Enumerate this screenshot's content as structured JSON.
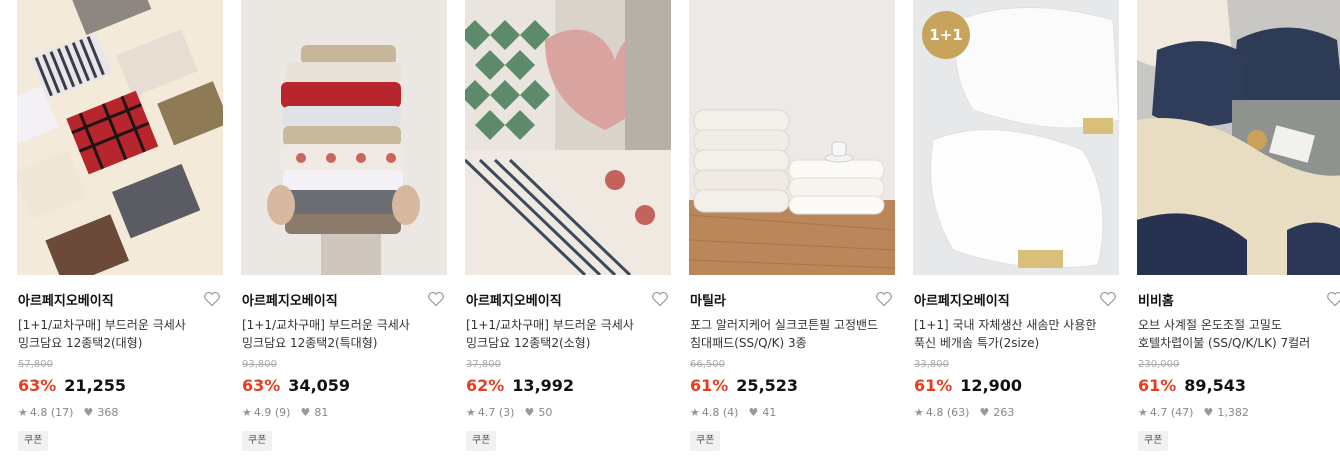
{
  "products": [
    {
      "brand": "아르페지오베이직",
      "title_line1": "[1+1/교차구매] 부드러운 극세사",
      "title_line2": "밍크담요 12종택2(대형)",
      "original_price": "57,800",
      "discount": "63%",
      "price": "21,255",
      "rating": "4.8",
      "reviews": "(17)",
      "likes": "368",
      "tag": "쿠폰"
    },
    {
      "brand": "아르페지오베이직",
      "title_line1": "[1+1/교차구매] 부드러운 극세사",
      "title_line2": "밍크담요 12종택2(특대형)",
      "original_price": "93,800",
      "discount": "63%",
      "price": "34,059",
      "rating": "4.9",
      "reviews": "(9)",
      "likes": "81",
      "tag": "쿠폰"
    },
    {
      "brand": "아르페지오베이직",
      "title_line1": "[1+1/교차구매] 부드러운 극세사",
      "title_line2": "밍크담요 12종택2(소형)",
      "original_price": "37,800",
      "discount": "62%",
      "price": "13,992",
      "rating": "4.7",
      "reviews": "(3)",
      "likes": "50",
      "tag": "쿠폰"
    },
    {
      "brand": "마틸라",
      "title_line1": "포그 알러지케어 실크코튼필 고정밴드",
      "title_line2": "침대패드(SS/Q/K) 3종",
      "original_price": "66,500",
      "discount": "61%",
      "price": "25,523",
      "rating": "4.8",
      "reviews": "(4)",
      "likes": "41",
      "tag": "쿠폰"
    },
    {
      "brand": "아르페지오베이직",
      "title_line1": "[1+1] 국내 자체생산 새솜만 사용한",
      "title_line2": "푹신 베개솜 특가(2size)",
      "original_price": "33,800",
      "discount": "61%",
      "price": "12,900",
      "rating": "4.8",
      "reviews": "(63)",
      "likes": "263",
      "badge": "1+1"
    },
    {
      "brand": "비비홈",
      "title_line1": "오브 사계절 온도조절 고밀도",
      "title_line2": "호텔차렵이불 (SS/Q/K/LK) 7컬러",
      "original_price": "230,000",
      "discount": "61%",
      "price": "89,543",
      "rating": "4.7",
      "reviews": "(47)",
      "likes": "1,382",
      "tag": "쿠폰"
    }
  ],
  "icons": {
    "wishlist": "heart-outline-icon",
    "rating": "star-icon",
    "likes": "heart-filled-icon"
  },
  "colors": {
    "discount": "#ea3c1e",
    "badge": "#c8a35c"
  }
}
